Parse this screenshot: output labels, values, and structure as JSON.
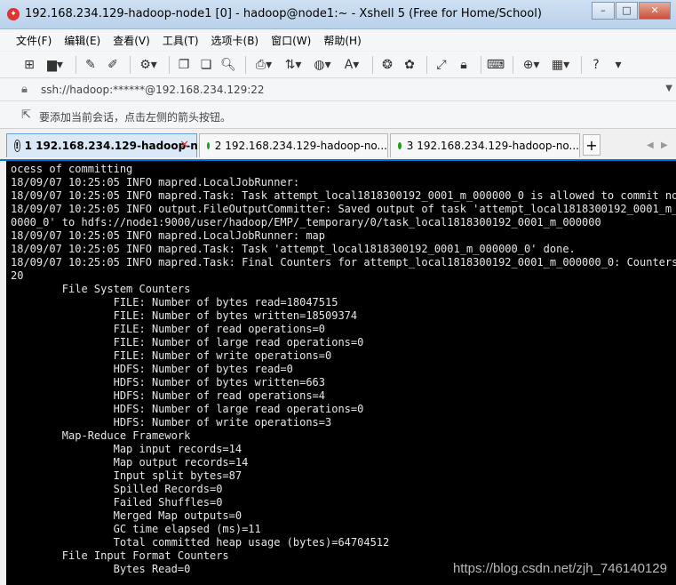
{
  "window": {
    "title": "192.168.234.129-hadoop-node1 [0] - hadoop@node1:~ - Xshell 5 (Free for Home/School)",
    "minimize_label": "–",
    "maximize_label": "□",
    "close_label": "✕"
  },
  "menu": [
    {
      "label": "文件(F)"
    },
    {
      "label": "编辑(E)"
    },
    {
      "label": "查看(V)"
    },
    {
      "label": "工具(T)"
    },
    {
      "label": "选项卡(B)"
    },
    {
      "label": "窗口(W)"
    },
    {
      "label": "帮助(H)"
    }
  ],
  "address": {
    "value": "ssh://hadoop:******@192.168.234.129:22"
  },
  "hint": {
    "text": "要添加当前会话，点击左侧的箭头按钮。"
  },
  "tabs": [
    {
      "label": "1 192.168.234.129-hadoop-n...",
      "active": true
    },
    {
      "label": "2 192.168.234.129-hadoop-no...",
      "active": false
    },
    {
      "label": "3 192.168.234.129-hadoop-no...",
      "active": false
    }
  ],
  "tab_add_label": "+",
  "terminal": {
    "lines": [
      "ocess of committing",
      "18/09/07 10:25:05 INFO mapred.LocalJobRunner:",
      "18/09/07 10:25:05 INFO mapred.Task: Task attempt_local1818300192_0001_m_000000_0 is allowed to commit now",
      "18/09/07 10:25:05 INFO output.FileOutputCommitter: Saved output of task 'attempt_local1818300192_0001_m_00",
      "0000_0' to hdfs://node1:9000/user/hadoop/EMP/_temporary/0/task_local1818300192_0001_m_000000",
      "18/09/07 10:25:05 INFO mapred.LocalJobRunner: map",
      "18/09/07 10:25:05 INFO mapred.Task: Task 'attempt_local1818300192_0001_m_000000_0' done.",
      "18/09/07 10:25:05 INFO mapred.Task: Final Counters for attempt_local1818300192_0001_m_000000_0: Counters:",
      "20",
      "        File System Counters",
      "                FILE: Number of bytes read=18047515",
      "                FILE: Number of bytes written=18509374",
      "                FILE: Number of read operations=0",
      "                FILE: Number of large read operations=0",
      "                FILE: Number of write operations=0",
      "                HDFS: Number of bytes read=0",
      "                HDFS: Number of bytes written=663",
      "                HDFS: Number of read operations=4",
      "                HDFS: Number of large read operations=0",
      "                HDFS: Number of write operations=3",
      "        Map-Reduce Framework",
      "                Map input records=14",
      "                Map output records=14",
      "                Input split bytes=87",
      "                Spilled Records=0",
      "                Failed Shuffles=0",
      "                Merged Map outputs=0",
      "                GC time elapsed (ms)=11",
      "                Total committed heap usage (bytes)=64704512",
      "        File Input Format Counters",
      "                Bytes Read=0"
    ]
  },
  "watermark": "https://blog.csdn.net/zjh_746140129",
  "colors": {
    "terminal_bg": "#000000",
    "terminal_fg": "#e6e6e6",
    "tab_accent": "#0078d7",
    "status_connected": "#1aa31a"
  }
}
